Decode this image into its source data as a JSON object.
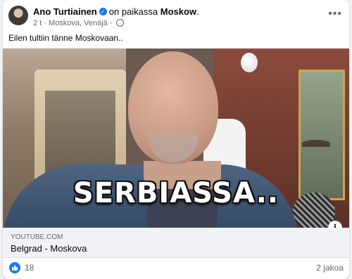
{
  "post": {
    "author": "Ano Turtiainen",
    "location_prefix": "on paikassa",
    "location": "Moskow",
    "location_suffix": ".",
    "time": "2 t",
    "place": "Moskova, Venäjä",
    "meta_separator": "·",
    "text": "Eilen tultiin tänne Moskovaan.."
  },
  "video": {
    "caption": "SERBIASSA..",
    "info_glyph": "i"
  },
  "link": {
    "domain": "YOUTUBE.COM",
    "title": "Belgrad - Moskova"
  },
  "reactions": {
    "count": "18",
    "shares": "2 jakoa"
  },
  "icons": {
    "verified": "verified-badge-icon",
    "globe": "globe-icon",
    "more": "more-options-icon",
    "like": "like-icon",
    "info": "info-icon"
  },
  "colors": {
    "accent": "#1877f2",
    "text": "#050505",
    "secondary": "#65676b"
  }
}
